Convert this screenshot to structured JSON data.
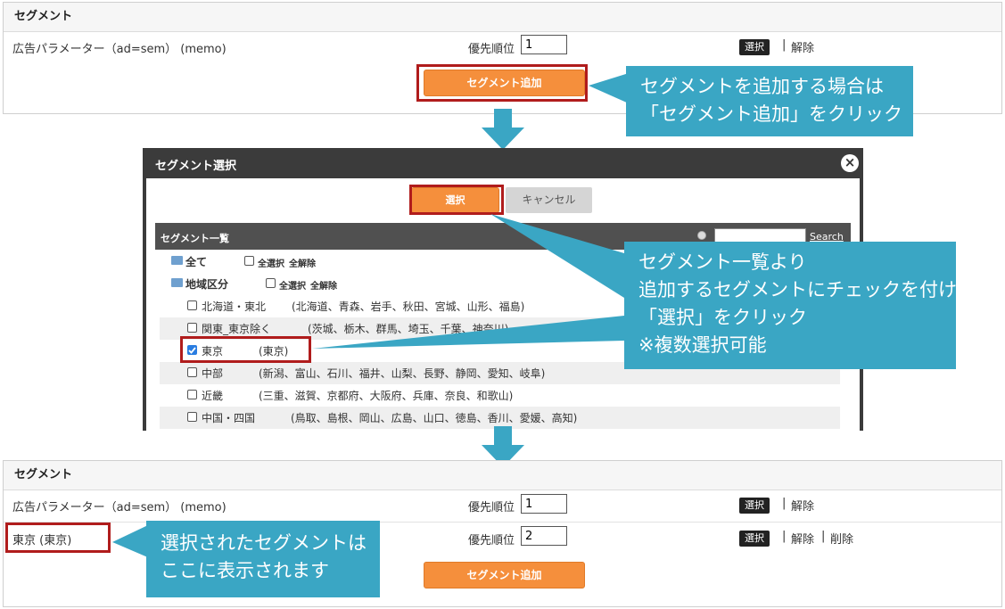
{
  "top_panel": {
    "title": "セグメント",
    "row_label": "広告パラメーター（ad=sem） (memo)",
    "priority_label": "優先順位",
    "priority_value": "1",
    "select_label": "選択",
    "sep": "|",
    "release_label": "解除",
    "add_button": "セグメント追加"
  },
  "callout1": {
    "line1": "セグメントを追加する場合は",
    "line2": "「セグメント追加」をクリック"
  },
  "modal": {
    "title": "セグメント選択",
    "close_icon": "×",
    "select_button": "選択",
    "cancel_button": "キャンセル",
    "list_title": "セグメント一覧",
    "search_button": "Search",
    "search_placeholder": "",
    "select_all": "全選択",
    "deselect_all": "全解除",
    "tree": [
      {
        "label": "全て",
        "detail": ""
      },
      {
        "label": "地域区分",
        "detail": ""
      },
      {
        "label": "北海道・東北",
        "detail": "(北海道、青森、岩手、秋田、宮城、山形、福島)",
        "checked": false
      },
      {
        "label": "関東_東京除く",
        "detail": "(茨城、栃木、群馬、埼玉、千葉、神奈川)",
        "checked": false
      },
      {
        "label": "東京",
        "detail": "(東京)",
        "checked": true
      },
      {
        "label": "中部",
        "detail": "(新潟、富山、石川、福井、山梨、長野、静岡、愛知、岐阜)",
        "checked": false
      },
      {
        "label": "近畿",
        "detail": "(三重、滋賀、京都府、大阪府、兵庫、奈良、和歌山)",
        "checked": false
      },
      {
        "label": "中国・四国",
        "detail": "(鳥取、島根、岡山、広島、山口、徳島、香川、愛媛、高知)",
        "checked": false
      }
    ]
  },
  "callout2": {
    "line1": "セグメント一覧より",
    "line2": "追加するセグメントにチェックを付け",
    "line3": "「選択」をクリック",
    "line4": "※複数選択可能"
  },
  "bottom_panel": {
    "title": "セグメント",
    "row1_label": "広告パラメーター（ad=sem） (memo)",
    "priority_label": "優先順位",
    "row1_priority": "1",
    "row2_label": "東京 (東京)",
    "row2_priority": "2",
    "select_label": "選択",
    "sep": "|",
    "release_label": "解除",
    "delete_label": "削除",
    "add_button": "セグメント追加"
  },
  "callout3": {
    "line1": "選択されたセグメントは",
    "line2": "ここに表示されます"
  },
  "colors": {
    "accent_orange": "#f58f3c",
    "callout_blue": "#3aa6c4",
    "highlight_red": "#b01c1c",
    "modal_dark": "#3b3b3b"
  },
  "icons": [
    "close-icon",
    "folder-icon",
    "checkbox-icon",
    "search-radio-icon",
    "down-arrow-icon"
  ]
}
